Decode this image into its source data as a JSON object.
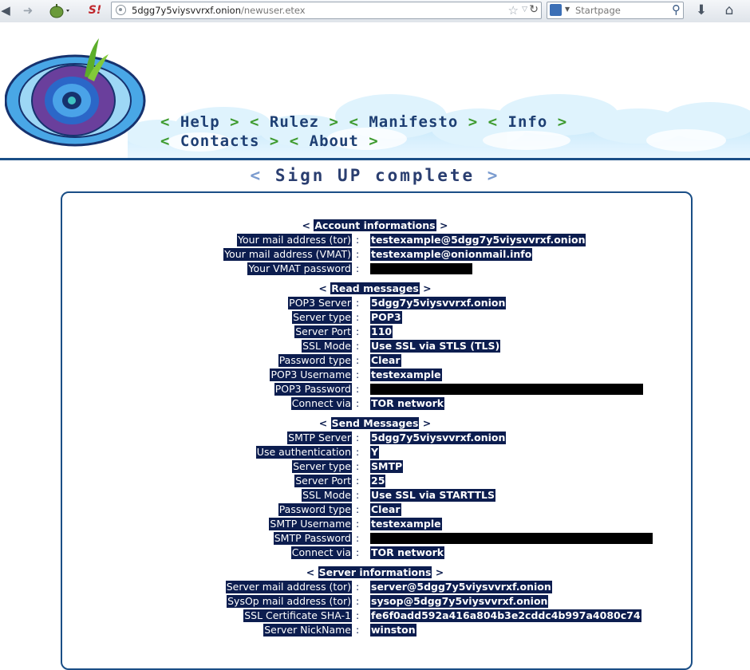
{
  "browser": {
    "url_host": "5dgg7y5viysvvrxf.onion",
    "url_path": "/newuser.etex",
    "search_placeholder": "Startpage"
  },
  "nav": {
    "row1": [
      "Help",
      "Rulez",
      "Manifesto",
      "Info"
    ],
    "row2": [
      "Contacts",
      "About"
    ]
  },
  "page_title": "Sign UP complete",
  "sections": {
    "account": {
      "title": "Account informations",
      "rows": [
        {
          "label": "Your mail address (tor)",
          "value": "testexample@5dgg7y5viysvvrxf.onion"
        },
        {
          "label": "Your mail address (VMAT)",
          "value": "testexample@onionmail.info"
        },
        {
          "label": "Your VMAT password",
          "value": ""
        }
      ]
    },
    "read": {
      "title": "Read messages",
      "rows": [
        {
          "label": "POP3 Server",
          "value": "5dgg7y5viysvvrxf.onion"
        },
        {
          "label": "Server type",
          "value": "POP3"
        },
        {
          "label": "Server Port",
          "value": "110"
        },
        {
          "label": "SSL Mode",
          "value": "Use SSL via STLS (TLS)"
        },
        {
          "label": "Password type",
          "value": "Clear"
        },
        {
          "label": "POP3 Username",
          "value": "testexample"
        },
        {
          "label": "POP3 Password",
          "value": ""
        },
        {
          "label": "Connect via",
          "value": "TOR network"
        }
      ]
    },
    "send": {
      "title": "Send Messages",
      "rows": [
        {
          "label": "SMTP Server",
          "value": "5dgg7y5viysvvrxf.onion"
        },
        {
          "label": "Use authentication",
          "value": "Y"
        },
        {
          "label": "Server type",
          "value": "SMTP"
        },
        {
          "label": "Server Port",
          "value": "25"
        },
        {
          "label": "SSL Mode",
          "value": "Use SSL via STARTTLS"
        },
        {
          "label": "Password type",
          "value": "Clear"
        },
        {
          "label": "SMTP Username",
          "value": "testexample"
        },
        {
          "label": "SMTP Password",
          "value": ""
        },
        {
          "label": "Connect via",
          "value": "TOR network"
        }
      ]
    },
    "server": {
      "title": "Server informations",
      "rows": [
        {
          "label": "Server mail address (tor)",
          "value": "server@5dgg7y5viysvvrxf.onion"
        },
        {
          "label": "SysOp mail address (tor)",
          "value": "sysop@5dgg7y5viysvvrxf.onion"
        },
        {
          "label": "SSL Certificate SHA-1",
          "value": "fe6f0add592a416a804b3e2cddc4b997a4080c74"
        },
        {
          "label": "Server NickName",
          "value": "winston"
        }
      ]
    }
  }
}
